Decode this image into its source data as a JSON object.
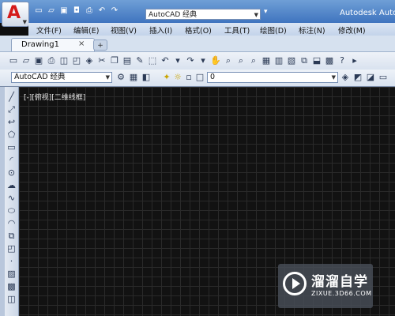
{
  "title_bar": {
    "app_menu_icon": "autocad-a-logo",
    "app_letter": "A",
    "workspace_value": "AutoCAD 经典",
    "title": "Autodesk AutoCAD",
    "quick_access_icons": [
      "new-icon",
      "open-icon",
      "save-icon",
      "save-as-icon",
      "print-icon",
      "undo-icon",
      "redo-icon"
    ]
  },
  "menu": {
    "items": [
      "文件(F)",
      "编辑(E)",
      "视图(V)",
      "插入(I)",
      "格式(O)",
      "工具(T)",
      "绘图(D)",
      "标注(N)",
      "修改(M)"
    ]
  },
  "tabs": {
    "document": "Drawing1",
    "close_glyph": "×",
    "new_tab_glyph": "+"
  },
  "toolbar2": {
    "workspace_value": "AutoCAD 经典",
    "layer_value": "0"
  },
  "viewport": {
    "label": "[-][俯视][二维线框]"
  },
  "watermark": {
    "title": "溜溜自学",
    "subtitle": "ZIXUE.3D66.COM"
  },
  "colors": {
    "title_bar": "#3f74bf",
    "canvas": "#121212",
    "grid": "#2a2a2a",
    "brand_red": "#d41b1b"
  }
}
